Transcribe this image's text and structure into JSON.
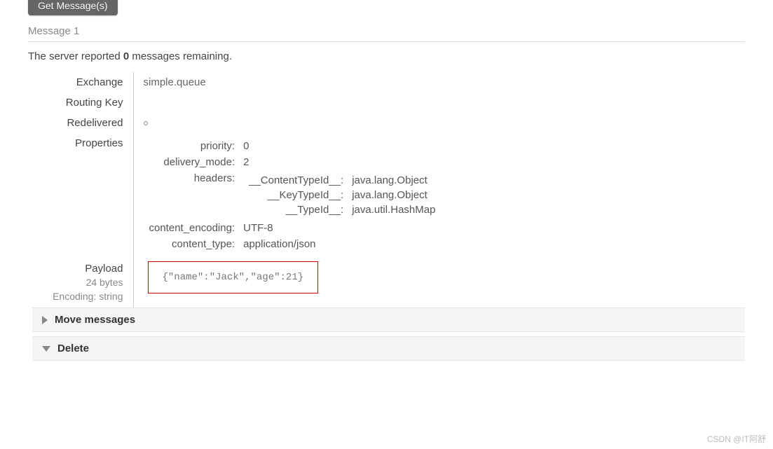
{
  "button": {
    "get_messages": "Get Message(s)"
  },
  "message_header": "Message 1",
  "status": {
    "prefix": "The server reported ",
    "count": "0",
    "suffix": " messages remaining."
  },
  "labels": {
    "exchange": "Exchange",
    "routing_key": "Routing Key",
    "redelivered": "Redelivered",
    "properties": "Properties",
    "payload": "Payload"
  },
  "detail": {
    "exchange": "simple.queue",
    "routing_key": "",
    "properties": {
      "priority": {
        "key": "priority:",
        "value": "0"
      },
      "delivery_mode": {
        "key": "delivery_mode:",
        "value": "2"
      },
      "headers_label": "headers:",
      "headers": [
        {
          "key": "__ContentTypeId__:",
          "value": "java.lang.Object"
        },
        {
          "key": "__KeyTypeId__:",
          "value": "java.lang.Object"
        },
        {
          "key": "__TypeId__:",
          "value": "java.util.HashMap"
        }
      ],
      "content_encoding": {
        "key": "content_encoding:",
        "value": "UTF-8"
      },
      "content_type": {
        "key": "content_type:",
        "value": "application/json"
      }
    },
    "payload": {
      "size": "24 bytes",
      "encoding_label": "Encoding: string",
      "body": "{\"name\":\"Jack\",\"age\":21}"
    }
  },
  "sections": {
    "move": "Move messages",
    "delete": "Delete"
  },
  "watermark": "CSDN @IT阿舒"
}
